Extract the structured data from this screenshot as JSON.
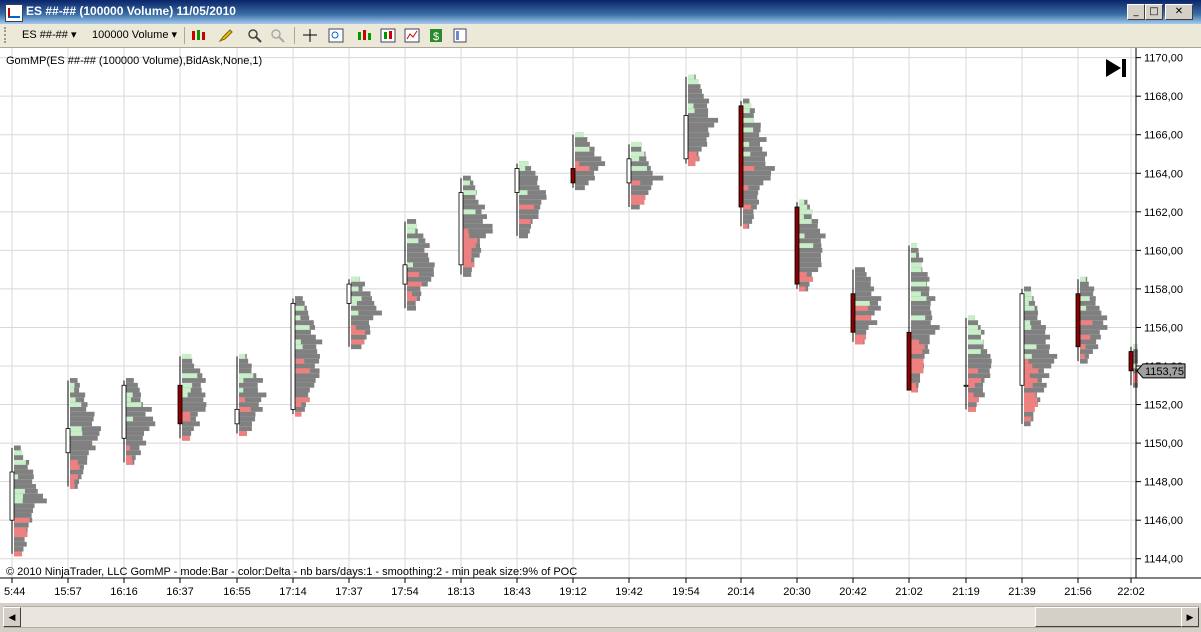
{
  "window": {
    "title": "ES ##-## (100000 Volume)  11/05/2010"
  },
  "toolbar": {
    "instrument": "ES ##-##",
    "period": "100000 Volume"
  },
  "chart": {
    "indicator_label": "GomMP(ES ##-## (100000 Volume),BidAsk,None,1)",
    "footer": "© 2010 NinjaTrader, LLC    GomMP - mode:Bar - color:Delta - nb bars/days:1  - smoothing:2 - min peak size:9% of POC",
    "last_price_label": "1153,75",
    "colors": {
      "up_body": "#ffffff",
      "down_body": "#8b0000",
      "profile": "#808080",
      "bid_delta": "#f08080",
      "ask_delta": "#c8f0c8",
      "grid": "#d8d8d8",
      "price_marker": "#a0a0a0"
    }
  },
  "chart_data": {
    "type": "candlestick+volume-profile",
    "ylim": [
      1143,
      1170.5
    ],
    "y_ticks": [
      "1144,00",
      "1146,00",
      "1148,00",
      "1150,00",
      "1152,00",
      "1154,00",
      "1156,00",
      "1158,00",
      "1160,00",
      "1162,00",
      "1164,00",
      "1166,00",
      "1168,00",
      "1170,00"
    ],
    "x_ticks": [
      "5:44",
      "15:57",
      "16:16",
      "16:37",
      "16:55",
      "17:14",
      "17:37",
      "17:54",
      "18:13",
      "18:43",
      "19:12",
      "19:42",
      "19:54",
      "20:14",
      "20:30",
      "20:42",
      "21:02",
      "21:19",
      "21:39",
      "21:56",
      "22:02"
    ],
    "last_price": 1153.75,
    "bars": [
      {
        "time": "5:44",
        "open": 1146.0,
        "close": 1148.5,
        "high": 1149.75,
        "low": 1144.25
      },
      {
        "time": "15:57",
        "open": 1149.5,
        "close": 1150.75,
        "high": 1153.25,
        "low": 1147.75
      },
      {
        "time": "16:16",
        "open": 1150.25,
        "close": 1153.0,
        "high": 1153.25,
        "low": 1149.0
      },
      {
        "time": "16:37",
        "open": 1153.0,
        "close": 1151.0,
        "high": 1154.5,
        "low": 1150.25
      },
      {
        "time": "16:55",
        "open": 1151.0,
        "close": 1151.75,
        "high": 1154.5,
        "low": 1150.5
      },
      {
        "time": "17:14",
        "open": 1151.75,
        "close": 1157.25,
        "high": 1157.5,
        "low": 1151.5
      },
      {
        "time": "17:37",
        "open": 1157.25,
        "close": 1158.25,
        "high": 1158.5,
        "low": 1155.0
      },
      {
        "time": "17:54",
        "open": 1158.25,
        "close": 1159.25,
        "high": 1161.5,
        "low": 1157.0
      },
      {
        "time": "18:13",
        "open": 1159.25,
        "close": 1163.0,
        "high": 1163.75,
        "low": 1158.75
      },
      {
        "time": "18:43",
        "open": 1163.0,
        "close": 1164.25,
        "high": 1164.5,
        "low": 1160.75
      },
      {
        "time": "19:12",
        "open": 1164.25,
        "close": 1163.5,
        "high": 1166.0,
        "low": 1163.25
      },
      {
        "time": "19:42",
        "open": 1163.5,
        "close": 1164.75,
        "high": 1165.5,
        "low": 1162.25
      },
      {
        "time": "19:54",
        "open": 1164.75,
        "close": 1167.0,
        "high": 1169.0,
        "low": 1164.5
      },
      {
        "time": "20:14",
        "open": 1167.5,
        "close": 1162.25,
        "high": 1167.75,
        "low": 1161.25
      },
      {
        "time": "20:30",
        "open": 1162.25,
        "close": 1158.25,
        "high": 1162.5,
        "low": 1158.0
      },
      {
        "time": "20:42",
        "open": 1157.75,
        "close": 1155.75,
        "high": 1159.0,
        "low": 1155.25
      },
      {
        "time": "21:02",
        "open": 1155.75,
        "close": 1152.75,
        "high": 1160.25,
        "low": 1152.75
      },
      {
        "time": "21:19",
        "open": 1153.0,
        "close": 1153.0,
        "high": 1156.5,
        "low": 1151.75
      },
      {
        "time": "21:39",
        "open": 1153.0,
        "close": 1157.75,
        "high": 1158.0,
        "low": 1151.0
      },
      {
        "time": "21:56",
        "open": 1157.75,
        "close": 1155.0,
        "high": 1158.5,
        "low": 1154.25
      },
      {
        "time": "22:02",
        "open": 1154.75,
        "close": 1153.75,
        "high": 1155.0,
        "low": 1153.0
      }
    ]
  }
}
